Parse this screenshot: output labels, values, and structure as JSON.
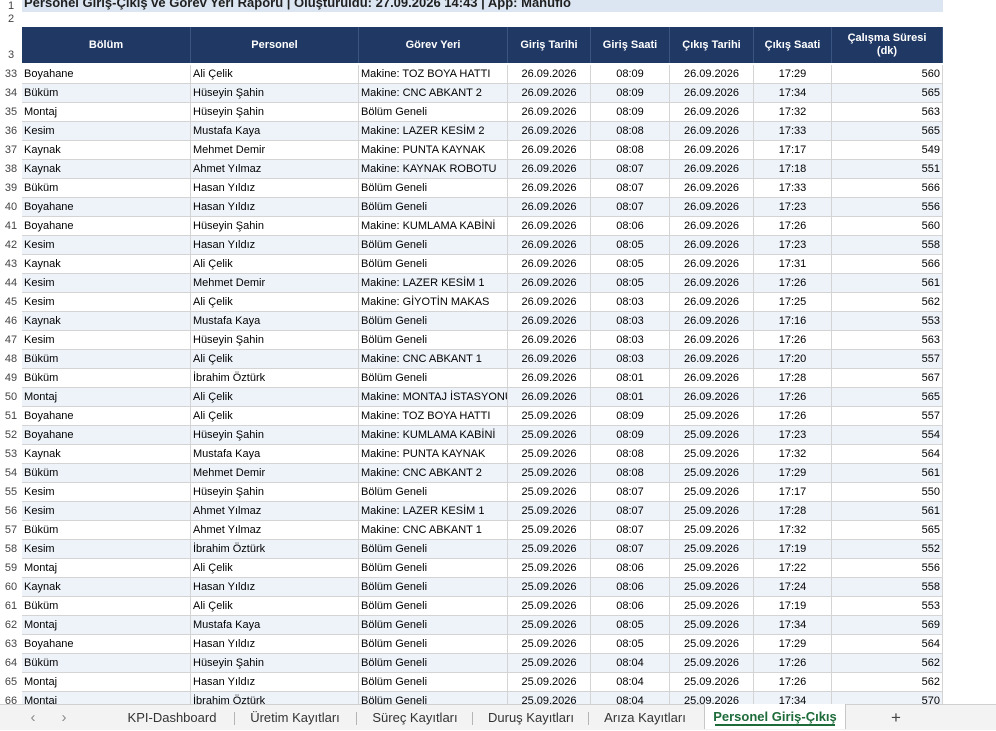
{
  "title": "Personel Giriş-Çıkış ve Görev Yeri Raporu  |  Oluşturuldu: 27.09.2026 14:43  |  App: Manufio",
  "headers": [
    "Bölüm",
    "Personel",
    "Görev Yeri",
    "Giriş Tarihi",
    "Giriş Saati",
    "Çıkış Tarihi",
    "Çıkış Saati",
    "Çalışma Süresi (dk)"
  ],
  "header_row_number": "3",
  "top_row_numbers": [
    "1",
    "2"
  ],
  "rows": [
    {
      "n": "33",
      "bolum": "Boyahane",
      "personel": "Ali Çelik",
      "gorev": "Makine: TOZ BOYA HATTI",
      "gt": "26.09.2026",
      "gs": "08:09",
      "ct": "26.09.2026",
      "cs": "17:29",
      "sure": "560"
    },
    {
      "n": "34",
      "bolum": "Büküm",
      "personel": "Hüseyin Şahin",
      "gorev": "Makine: CNC ABKANT 2",
      "gt": "26.09.2026",
      "gs": "08:09",
      "ct": "26.09.2026",
      "cs": "17:34",
      "sure": "565"
    },
    {
      "n": "35",
      "bolum": "Montaj",
      "personel": "Hüseyin Şahin",
      "gorev": "Bölüm Geneli",
      "gt": "26.09.2026",
      "gs": "08:09",
      "ct": "26.09.2026",
      "cs": "17:32",
      "sure": "563"
    },
    {
      "n": "36",
      "bolum": "Kesim",
      "personel": "Mustafa Kaya",
      "gorev": "Makine: LAZER KESİM 2",
      "gt": "26.09.2026",
      "gs": "08:08",
      "ct": "26.09.2026",
      "cs": "17:33",
      "sure": "565"
    },
    {
      "n": "37",
      "bolum": "Kaynak",
      "personel": "Mehmet Demir",
      "gorev": "Makine: PUNTA KAYNAK",
      "gt": "26.09.2026",
      "gs": "08:08",
      "ct": "26.09.2026",
      "cs": "17:17",
      "sure": "549"
    },
    {
      "n": "38",
      "bolum": "Kaynak",
      "personel": "Ahmet Yılmaz",
      "gorev": "Makine: KAYNAK ROBOTU",
      "gt": "26.09.2026",
      "gs": "08:07",
      "ct": "26.09.2026",
      "cs": "17:18",
      "sure": "551"
    },
    {
      "n": "39",
      "bolum": "Büküm",
      "personel": "Hasan Yıldız",
      "gorev": "Bölüm Geneli",
      "gt": "26.09.2026",
      "gs": "08:07",
      "ct": "26.09.2026",
      "cs": "17:33",
      "sure": "566"
    },
    {
      "n": "40",
      "bolum": "Boyahane",
      "personel": "Hasan Yıldız",
      "gorev": "Bölüm Geneli",
      "gt": "26.09.2026",
      "gs": "08:07",
      "ct": "26.09.2026",
      "cs": "17:23",
      "sure": "556"
    },
    {
      "n": "41",
      "bolum": "Boyahane",
      "personel": "Hüseyin Şahin",
      "gorev": "Makine: KUMLAMA KABİNİ",
      "gt": "26.09.2026",
      "gs": "08:06",
      "ct": "26.09.2026",
      "cs": "17:26",
      "sure": "560"
    },
    {
      "n": "42",
      "bolum": "Kesim",
      "personel": "Hasan Yıldız",
      "gorev": "Bölüm Geneli",
      "gt": "26.09.2026",
      "gs": "08:05",
      "ct": "26.09.2026",
      "cs": "17:23",
      "sure": "558"
    },
    {
      "n": "43",
      "bolum": "Kaynak",
      "personel": "Ali Çelik",
      "gorev": "Bölüm Geneli",
      "gt": "26.09.2026",
      "gs": "08:05",
      "ct": "26.09.2026",
      "cs": "17:31",
      "sure": "566"
    },
    {
      "n": "44",
      "bolum": "Kesim",
      "personel": "Mehmet Demir",
      "gorev": "Makine: LAZER KESİM 1",
      "gt": "26.09.2026",
      "gs": "08:05",
      "ct": "26.09.2026",
      "cs": "17:26",
      "sure": "561"
    },
    {
      "n": "45",
      "bolum": "Kesim",
      "personel": "Ali Çelik",
      "gorev": "Makine: GİYOTİN MAKAS",
      "gt": "26.09.2026",
      "gs": "08:03",
      "ct": "26.09.2026",
      "cs": "17:25",
      "sure": "562"
    },
    {
      "n": "46",
      "bolum": "Kaynak",
      "personel": "Mustafa Kaya",
      "gorev": "Bölüm Geneli",
      "gt": "26.09.2026",
      "gs": "08:03",
      "ct": "26.09.2026",
      "cs": "17:16",
      "sure": "553"
    },
    {
      "n": "47",
      "bolum": "Kesim",
      "personel": "Hüseyin Şahin",
      "gorev": "Bölüm Geneli",
      "gt": "26.09.2026",
      "gs": "08:03",
      "ct": "26.09.2026",
      "cs": "17:26",
      "sure": "563"
    },
    {
      "n": "48",
      "bolum": "Büküm",
      "personel": "Ali Çelik",
      "gorev": "Makine: CNC ABKANT 1",
      "gt": "26.09.2026",
      "gs": "08:03",
      "ct": "26.09.2026",
      "cs": "17:20",
      "sure": "557"
    },
    {
      "n": "49",
      "bolum": "Büküm",
      "personel": "İbrahim Öztürk",
      "gorev": "Bölüm Geneli",
      "gt": "26.09.2026",
      "gs": "08:01",
      "ct": "26.09.2026",
      "cs": "17:28",
      "sure": "567"
    },
    {
      "n": "50",
      "bolum": "Montaj",
      "personel": "Ali Çelik",
      "gorev": "Makine: MONTAJ İSTASYONU",
      "gt": "26.09.2026",
      "gs": "08:01",
      "ct": "26.09.2026",
      "cs": "17:26",
      "sure": "565"
    },
    {
      "n": "51",
      "bolum": "Boyahane",
      "personel": "Ali Çelik",
      "gorev": "Makine: TOZ BOYA HATTI",
      "gt": "25.09.2026",
      "gs": "08:09",
      "ct": "25.09.2026",
      "cs": "17:26",
      "sure": "557"
    },
    {
      "n": "52",
      "bolum": "Boyahane",
      "personel": "Hüseyin Şahin",
      "gorev": "Makine: KUMLAMA KABİNİ",
      "gt": "25.09.2026",
      "gs": "08:09",
      "ct": "25.09.2026",
      "cs": "17:23",
      "sure": "554"
    },
    {
      "n": "53",
      "bolum": "Kaynak",
      "personel": "Mustafa Kaya",
      "gorev": "Makine: PUNTA KAYNAK",
      "gt": "25.09.2026",
      "gs": "08:08",
      "ct": "25.09.2026",
      "cs": "17:32",
      "sure": "564"
    },
    {
      "n": "54",
      "bolum": "Büküm",
      "personel": "Mehmet Demir",
      "gorev": "Makine: CNC ABKANT 2",
      "gt": "25.09.2026",
      "gs": "08:08",
      "ct": "25.09.2026",
      "cs": "17:29",
      "sure": "561"
    },
    {
      "n": "55",
      "bolum": "Kesim",
      "personel": "Hüseyin Şahin",
      "gorev": "Bölüm Geneli",
      "gt": "25.09.2026",
      "gs": "08:07",
      "ct": "25.09.2026",
      "cs": "17:17",
      "sure": "550"
    },
    {
      "n": "56",
      "bolum": "Kesim",
      "personel": "Ahmet Yılmaz",
      "gorev": "Makine: LAZER KESİM 1",
      "gt": "25.09.2026",
      "gs": "08:07",
      "ct": "25.09.2026",
      "cs": "17:28",
      "sure": "561"
    },
    {
      "n": "57",
      "bolum": "Büküm",
      "personel": "Ahmet Yılmaz",
      "gorev": "Makine: CNC ABKANT 1",
      "gt": "25.09.2026",
      "gs": "08:07",
      "ct": "25.09.2026",
      "cs": "17:32",
      "sure": "565"
    },
    {
      "n": "58",
      "bolum": "Kesim",
      "personel": "İbrahim Öztürk",
      "gorev": "Bölüm Geneli",
      "gt": "25.09.2026",
      "gs": "08:07",
      "ct": "25.09.2026",
      "cs": "17:19",
      "sure": "552"
    },
    {
      "n": "59",
      "bolum": "Montaj",
      "personel": "Ali Çelik",
      "gorev": "Bölüm Geneli",
      "gt": "25.09.2026",
      "gs": "08:06",
      "ct": "25.09.2026",
      "cs": "17:22",
      "sure": "556"
    },
    {
      "n": "60",
      "bolum": "Kaynak",
      "personel": "Hasan Yıldız",
      "gorev": "Bölüm Geneli",
      "gt": "25.09.2026",
      "gs": "08:06",
      "ct": "25.09.2026",
      "cs": "17:24",
      "sure": "558"
    },
    {
      "n": "61",
      "bolum": "Büküm",
      "personel": "Ali Çelik",
      "gorev": "Bölüm Geneli",
      "gt": "25.09.2026",
      "gs": "08:06",
      "ct": "25.09.2026",
      "cs": "17:19",
      "sure": "553"
    },
    {
      "n": "62",
      "bolum": "Montaj",
      "personel": "Mustafa Kaya",
      "gorev": "Bölüm Geneli",
      "gt": "25.09.2026",
      "gs": "08:05",
      "ct": "25.09.2026",
      "cs": "17:34",
      "sure": "569"
    },
    {
      "n": "63",
      "bolum": "Boyahane",
      "personel": "Hasan Yıldız",
      "gorev": "Bölüm Geneli",
      "gt": "25.09.2026",
      "gs": "08:05",
      "ct": "25.09.2026",
      "cs": "17:29",
      "sure": "564"
    },
    {
      "n": "64",
      "bolum": "Büküm",
      "personel": "Hüseyin Şahin",
      "gorev": "Bölüm Geneli",
      "gt": "25.09.2026",
      "gs": "08:04",
      "ct": "25.09.2026",
      "cs": "17:26",
      "sure": "562"
    },
    {
      "n": "65",
      "bolum": "Montaj",
      "personel": "Hasan Yıldız",
      "gorev": "Bölüm Geneli",
      "gt": "25.09.2026",
      "gs": "08:04",
      "ct": "25.09.2026",
      "cs": "17:26",
      "sure": "562"
    },
    {
      "n": "66",
      "bolum": "Montaj",
      "personel": "İbrahim Öztürk",
      "gorev": "Bölüm Geneli",
      "gt": "25.09.2026",
      "gs": "08:04",
      "ct": "25.09.2026",
      "cs": "17:34",
      "sure": "570"
    }
  ],
  "tabs": [
    "KPI-Dashboard",
    "Üretim Kayıtları",
    "Süreç Kayıtları",
    "Duruş Kayıtları",
    "Arıza Kayıtları",
    "Personel Giriş-Çıkış"
  ],
  "active_tab": "Personel Giriş-Çıkış",
  "nav": {
    "prev_icon": "‹",
    "next_icon": "›",
    "add_icon": "+"
  },
  "colors": {
    "header_bg": "#1f3864",
    "title_bg": "#dce6f2",
    "alt_row": "#eef3fa",
    "active_tab_text": "#1e6b3a"
  }
}
